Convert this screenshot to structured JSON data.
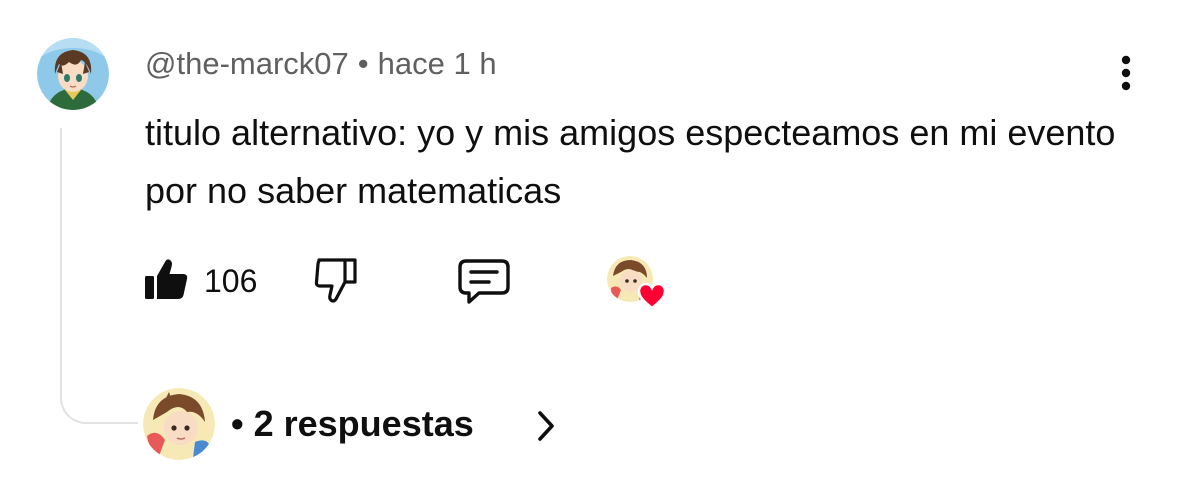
{
  "comment": {
    "author": "@the-marck07",
    "separator": "•",
    "timestamp": "hace 1 h",
    "text": "titulo alternativo: yo y mis amigos especteamos en mi evento por no saber matematicas",
    "avatar_icon": "anime-character-avatar"
  },
  "actions": {
    "like_count": "106",
    "like_icon": "thumbs-up-filled-icon",
    "dislike_icon": "thumbs-down-outline-icon",
    "reply_icon": "comment-bubble-icon",
    "creator_heart_icon": "heart-icon",
    "heart_color": "#ff0033"
  },
  "replies": {
    "separator": "•",
    "label": "2 respuestas",
    "chevron_icon": "chevron-right-icon"
  },
  "menu": {
    "icon": "more-vert-icon"
  },
  "colors": {
    "text_primary": "#0f0f0f",
    "text_secondary": "#606060",
    "thread_line": "#e2e2e2"
  }
}
